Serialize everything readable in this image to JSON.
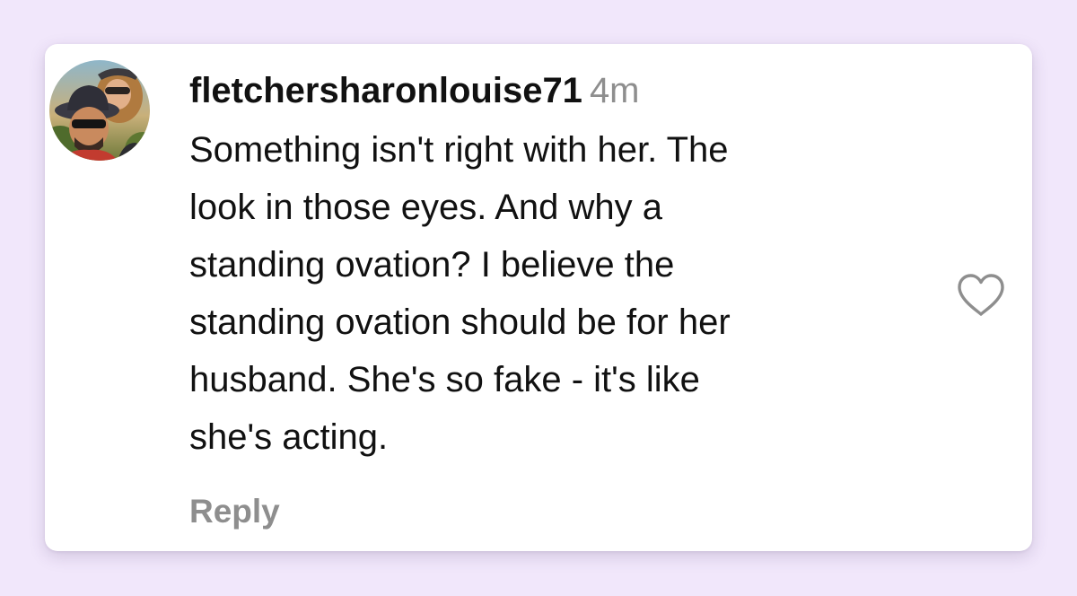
{
  "comment": {
    "username": "fletchersharonlouise71",
    "timestamp": "4m",
    "text_lines": [
      "Something isn't right with her. The",
      "look in those eyes. And why a",
      "standing ovation? I believe the",
      "standing ovation should be for her",
      "husband. She's so fake - it's like",
      "she's acting."
    ],
    "reply_label": "Reply",
    "like_icon": "heart-outline-icon"
  },
  "colors": {
    "background": "#f1e7fb",
    "card": "#ffffff",
    "text": "#111111",
    "muted": "#8e8e8e"
  }
}
